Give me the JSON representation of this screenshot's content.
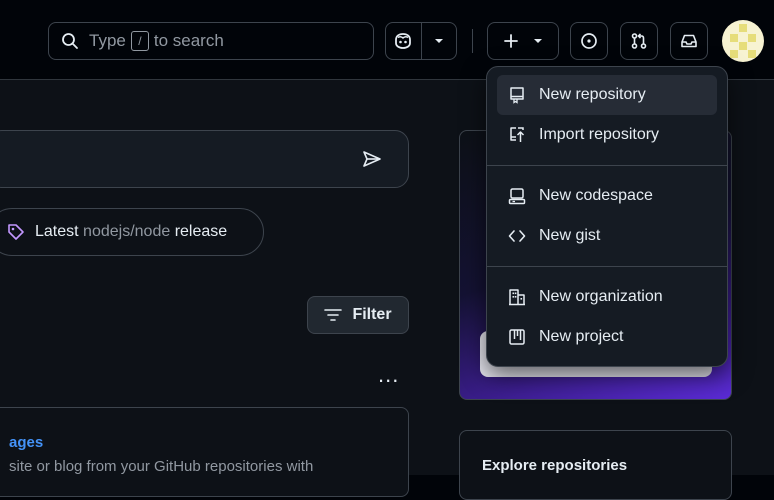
{
  "header": {
    "search": {
      "prefix": "Type",
      "key": "/",
      "suffix": "to search"
    }
  },
  "main": {
    "chat_pill": {
      "part1": "Latest",
      "repo": "nodejs/node",
      "part2": "release"
    },
    "filter_label": "Filter",
    "more_label": "...",
    "pages_card": {
      "title": "ages",
      "desc": "site or blog from your GitHub repositories with"
    },
    "explore_title": "Explore repositories"
  },
  "create_menu": {
    "items": [
      {
        "label": "New repository",
        "icon": "repo-icon"
      },
      {
        "label": "Import repository",
        "icon": "repo-push-icon"
      },
      {
        "label": "New codespace",
        "icon": "codespaces-icon"
      },
      {
        "label": "New gist",
        "icon": "code-icon"
      },
      {
        "label": "New organization",
        "icon": "organization-icon"
      },
      {
        "label": "New project",
        "icon": "project-icon"
      }
    ]
  },
  "colors": {
    "bg": "#010409",
    "panel": "#0d1117",
    "menu_bg": "#151b23",
    "border": "#3d444d",
    "link": "#4493f8",
    "text": "#e6edf3",
    "muted": "#9198a1"
  }
}
